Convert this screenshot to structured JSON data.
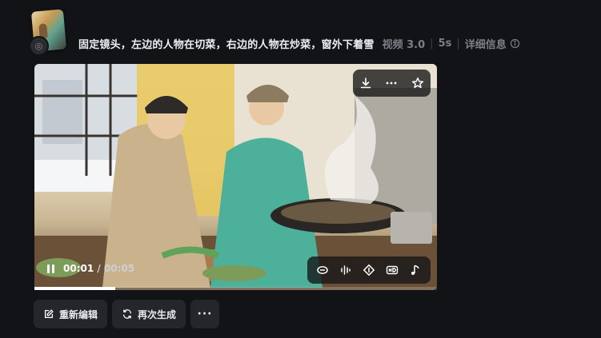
{
  "card": {
    "prompt": "固定镜头，左边的人物在切菜，右边的人物在炒菜，窗外下着雪",
    "model": "视频 3.0",
    "duration": "5s",
    "details_label": "详细信息"
  },
  "player": {
    "current_time": "00:01",
    "total_time": "00:05",
    "progress_fraction": 0.2
  },
  "actions": {
    "re_edit_label": "重新编辑",
    "regenerate_label": "再次生成",
    "more_label": "···"
  },
  "icons": {
    "top_toolbar": [
      "download-icon",
      "more-icon",
      "star-icon"
    ],
    "bottom_toolbar": [
      "loop-icon",
      "audio-wave-icon",
      "frame-interp-icon",
      "hd-icon",
      "music-icon"
    ]
  },
  "colors": {
    "background": "#121316",
    "button_bg": "#25262b",
    "muted_text": "#7c7f87"
  }
}
